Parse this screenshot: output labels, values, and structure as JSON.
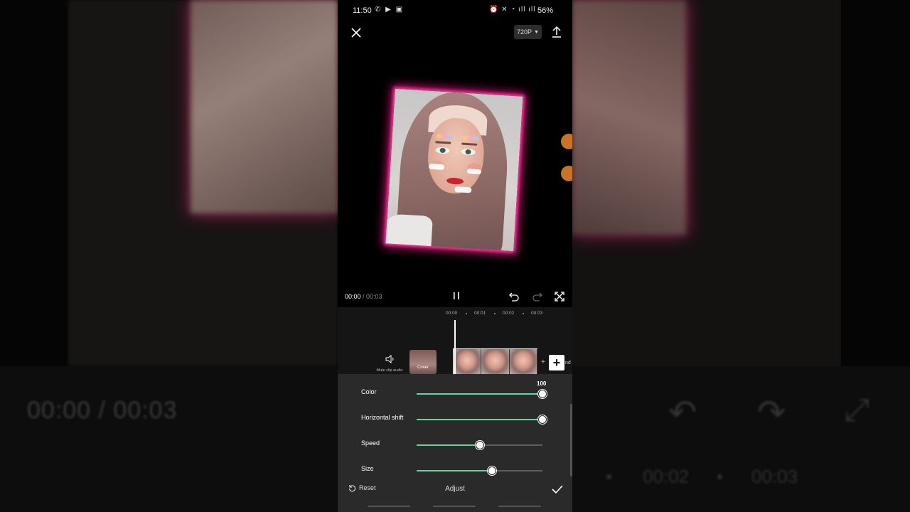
{
  "status": {
    "time": "11:50",
    "battery": "56%",
    "left_icons": "signal-icons",
    "right_icons": "alarm-icon, mute-icon, wifi-icon, signal-icon"
  },
  "toolbar": {
    "resolution": "720P"
  },
  "player": {
    "current": "00:00",
    "separator": " / ",
    "total": "00:03"
  },
  "timeline": {
    "ruler": [
      "00:00",
      "00:01",
      "00:02",
      "00:03"
    ],
    "mute_label": "Mute clip audio",
    "cover_label": "Cover",
    "end_label": "nd"
  },
  "adjust": {
    "sliders": [
      {
        "label": "Color",
        "value": 100,
        "value_text": "100",
        "max": 100
      },
      {
        "label": "Horizontal shift",
        "value": 100,
        "max": 100
      },
      {
        "label": "Speed",
        "value": 50,
        "max": 100
      },
      {
        "label": "Size",
        "value": 60,
        "max": 100
      }
    ],
    "reset_label": "Reset",
    "title": "Adjust"
  },
  "background_mirror": {
    "time": "00:00 / 00:03",
    "ticks": [
      "00:02",
      "00:03"
    ]
  },
  "colors": {
    "accent": "#5fd6a4",
    "glow": "#e0157a",
    "panel": "#2a2a2a"
  }
}
